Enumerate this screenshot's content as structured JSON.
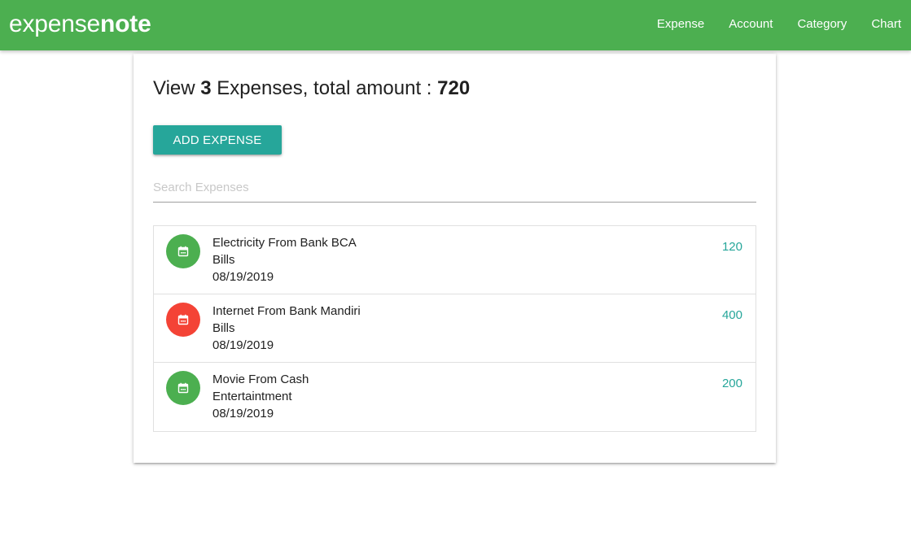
{
  "brand": {
    "part1": "expense",
    "part2": "note"
  },
  "nav": [
    "Expense",
    "Account",
    "Category",
    "Chart"
  ],
  "header": {
    "prefix": "View",
    "count": "3",
    "middle": "Expenses, total amount :",
    "total": "720"
  },
  "add_button_label": "ADD EXPENSE",
  "search": {
    "placeholder": "Search Expenses",
    "value": ""
  },
  "expenses": [
    {
      "title": "Electricity From Bank BCA",
      "category": "Bills",
      "date": "08/19/2019",
      "amount": "120",
      "icon": "calendar-icon",
      "color": "#4caf50"
    },
    {
      "title": "Internet From Bank Mandiri",
      "category": "Bills",
      "date": "08/19/2019",
      "amount": "400",
      "icon": "calendar-icon",
      "color": "#f44336"
    },
    {
      "title": "Movie From Cash",
      "category": "Entertaintment",
      "date": "08/19/2019",
      "amount": "200",
      "icon": "calendar-icon",
      "color": "#4caf50"
    }
  ],
  "colors": {
    "navbar": "#4caf50",
    "button": "#26a69a",
    "amount": "#26a69a"
  }
}
